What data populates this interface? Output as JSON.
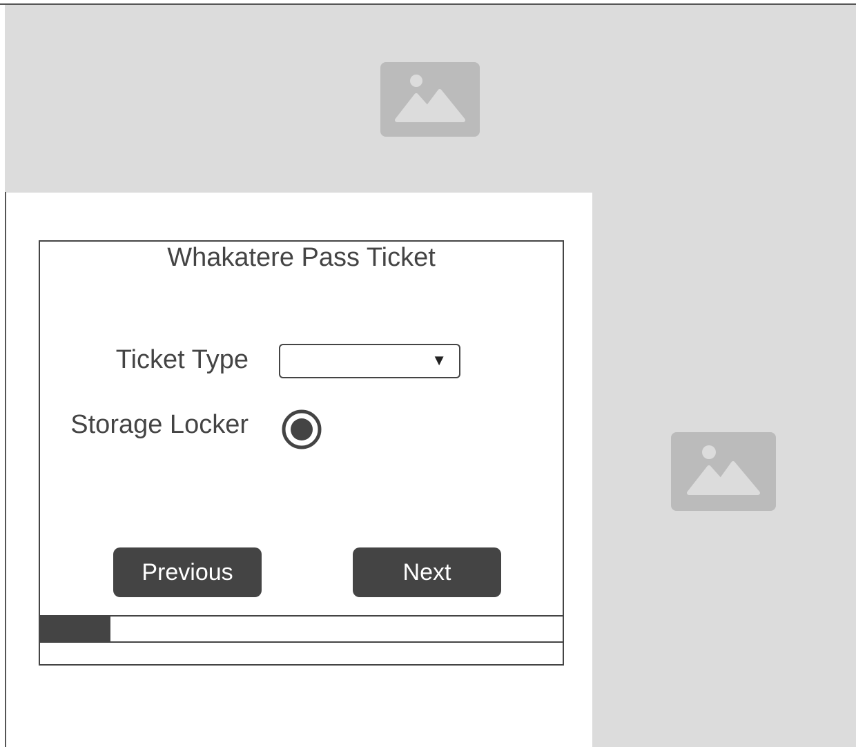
{
  "form": {
    "title": "Whakatere Pass Ticket",
    "ticket_type": {
      "label": "Ticket Type",
      "selected_value": ""
    },
    "storage_locker": {
      "label": "Storage Locker",
      "selected": true
    },
    "buttons": {
      "previous_label": "Previous",
      "next_label": "Next"
    },
    "progress": {
      "fraction": 0.135
    }
  },
  "images": {
    "hero": {
      "icon": "image-placeholder-icon"
    },
    "side": {
      "icon": "image-placeholder-icon"
    }
  },
  "colors": {
    "dark": "#444444",
    "placeholder_bg": "#dcdcdc",
    "placeholder_icon": "#bbbbbb"
  }
}
